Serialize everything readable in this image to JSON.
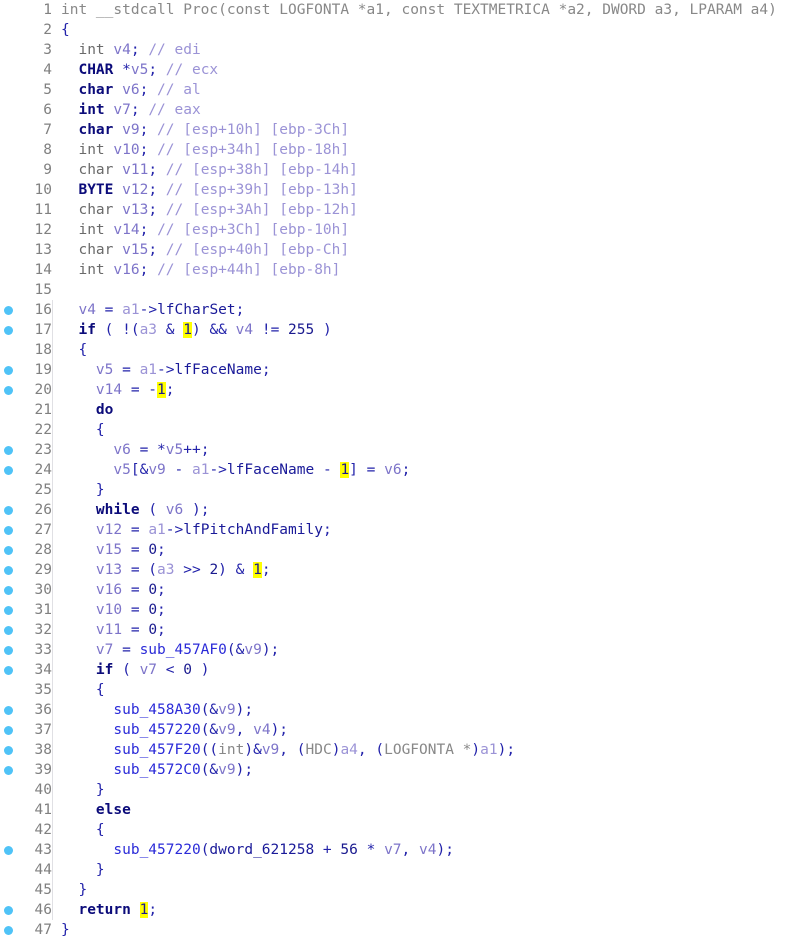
{
  "editor": {
    "kind": "decompiler-pseudocode-view",
    "accent_breakpoint_color": "#4fc3f7",
    "highlight_color": "#ffff00",
    "background_color": "#ffffff",
    "gutter_number_color": "#808080",
    "total_lines": 47
  },
  "lines": [
    {
      "n": "1",
      "bp": false,
      "tokens": [
        {
          "c": "t-grey",
          "s": "int __stdcall Proc(const LOGFONTA *a1, const TEXTMETRICA *a2, DWORD a3, LPARAM a4)"
        }
      ]
    },
    {
      "n": "2",
      "bp": false,
      "tokens": [
        {
          "c": "t-sym",
          "s": "{"
        }
      ]
    },
    {
      "n": "3",
      "bp": false,
      "tokens": [
        {
          "c": "t-plain",
          "s": "  int "
        },
        {
          "c": "t-var",
          "s": "v4"
        },
        {
          "c": "t-sym",
          "s": "; "
        },
        {
          "c": "t-comment",
          "s": "// edi"
        }
      ]
    },
    {
      "n": "4",
      "bp": false,
      "tokens": [
        {
          "c": "t-type",
          "s": "  CHAR "
        },
        {
          "c": "t-sym",
          "s": "*"
        },
        {
          "c": "t-var",
          "s": "v5"
        },
        {
          "c": "t-sym",
          "s": "; "
        },
        {
          "c": "t-comment",
          "s": "// ecx"
        }
      ]
    },
    {
      "n": "5",
      "bp": false,
      "tokens": [
        {
          "c": "t-type",
          "s": "  char "
        },
        {
          "c": "t-var",
          "s": "v6"
        },
        {
          "c": "t-sym",
          "s": "; "
        },
        {
          "c": "t-comment",
          "s": "// al"
        }
      ]
    },
    {
      "n": "6",
      "bp": false,
      "tokens": [
        {
          "c": "t-type",
          "s": "  int "
        },
        {
          "c": "t-var",
          "s": "v7"
        },
        {
          "c": "t-sym",
          "s": "; "
        },
        {
          "c": "t-comment",
          "s": "// eax"
        }
      ]
    },
    {
      "n": "7",
      "bp": false,
      "tokens": [
        {
          "c": "t-type",
          "s": "  char "
        },
        {
          "c": "t-var",
          "s": "v9"
        },
        {
          "c": "t-sym",
          "s": "; "
        },
        {
          "c": "t-comment",
          "s": "// [esp+10h] [ebp-3Ch]"
        }
      ]
    },
    {
      "n": "8",
      "bp": false,
      "tokens": [
        {
          "c": "t-plain",
          "s": "  int "
        },
        {
          "c": "t-var",
          "s": "v10"
        },
        {
          "c": "t-sym",
          "s": "; "
        },
        {
          "c": "t-comment",
          "s": "// [esp+34h] [ebp-18h]"
        }
      ]
    },
    {
      "n": "9",
      "bp": false,
      "tokens": [
        {
          "c": "t-plain",
          "s": "  char "
        },
        {
          "c": "t-var",
          "s": "v11"
        },
        {
          "c": "t-sym",
          "s": "; "
        },
        {
          "c": "t-comment",
          "s": "// [esp+38h] [ebp-14h]"
        }
      ]
    },
    {
      "n": "10",
      "bp": false,
      "tokens": [
        {
          "c": "t-type",
          "s": "  BYTE "
        },
        {
          "c": "t-var",
          "s": "v12"
        },
        {
          "c": "t-sym",
          "s": "; "
        },
        {
          "c": "t-comment",
          "s": "// [esp+39h] [ebp-13h]"
        }
      ]
    },
    {
      "n": "11",
      "bp": false,
      "tokens": [
        {
          "c": "t-plain",
          "s": "  char "
        },
        {
          "c": "t-var",
          "s": "v13"
        },
        {
          "c": "t-sym",
          "s": "; "
        },
        {
          "c": "t-comment",
          "s": "// [esp+3Ah] [ebp-12h]"
        }
      ]
    },
    {
      "n": "12",
      "bp": false,
      "tokens": [
        {
          "c": "t-plain",
          "s": "  int "
        },
        {
          "c": "t-var",
          "s": "v14"
        },
        {
          "c": "t-sym",
          "s": "; "
        },
        {
          "c": "t-comment",
          "s": "// [esp+3Ch] [ebp-10h]"
        }
      ]
    },
    {
      "n": "13",
      "bp": false,
      "tokens": [
        {
          "c": "t-plain",
          "s": "  char "
        },
        {
          "c": "t-var",
          "s": "v15"
        },
        {
          "c": "t-sym",
          "s": "; "
        },
        {
          "c": "t-comment",
          "s": "// [esp+40h] [ebp-Ch]"
        }
      ]
    },
    {
      "n": "14",
      "bp": false,
      "tokens": [
        {
          "c": "t-plain",
          "s": "  int "
        },
        {
          "c": "t-var",
          "s": "v16"
        },
        {
          "c": "t-sym",
          "s": "; "
        },
        {
          "c": "t-comment",
          "s": "// [esp+44h] [ebp-8h]"
        }
      ]
    },
    {
      "n": "15",
      "bp": false,
      "tokens": []
    },
    {
      "n": "16",
      "bp": true,
      "tokens": [
        {
          "c": "t-var",
          "s": "  v4 "
        },
        {
          "c": "t-sym",
          "s": "= "
        },
        {
          "c": "t-arg",
          "s": "a1"
        },
        {
          "c": "t-sym",
          "s": "->"
        },
        {
          "c": "t-member",
          "s": "lfCharSet"
        },
        {
          "c": "t-sym",
          "s": ";"
        }
      ]
    },
    {
      "n": "17",
      "bp": true,
      "tokens": [
        {
          "c": "t-kw",
          "s": "  if "
        },
        {
          "c": "t-sym",
          "s": "( !("
        },
        {
          "c": "t-arg",
          "s": "a3"
        },
        {
          "c": "t-sym",
          "s": " & "
        },
        {
          "c": "t-hl",
          "s": "1"
        },
        {
          "c": "t-sym",
          "s": ") && "
        },
        {
          "c": "t-var",
          "s": "v4"
        },
        {
          "c": "t-sym",
          "s": " != "
        },
        {
          "c": "t-num",
          "s": "255"
        },
        {
          "c": "t-sym",
          "s": " )"
        }
      ]
    },
    {
      "n": "18",
      "bp": false,
      "tokens": [
        {
          "c": "t-sym",
          "s": "  {"
        }
      ]
    },
    {
      "n": "19",
      "bp": true,
      "tokens": [
        {
          "c": "t-var",
          "s": "    v5 "
        },
        {
          "c": "t-sym",
          "s": "= "
        },
        {
          "c": "t-arg",
          "s": "a1"
        },
        {
          "c": "t-sym",
          "s": "->"
        },
        {
          "c": "t-member",
          "s": "lfFaceName"
        },
        {
          "c": "t-sym",
          "s": ";"
        }
      ]
    },
    {
      "n": "20",
      "bp": true,
      "tokens": [
        {
          "c": "t-var",
          "s": "    v14 "
        },
        {
          "c": "t-sym",
          "s": "= -"
        },
        {
          "c": "t-hl",
          "s": "1"
        },
        {
          "c": "t-sym",
          "s": ";"
        }
      ]
    },
    {
      "n": "21",
      "bp": false,
      "tokens": [
        {
          "c": "t-kw",
          "s": "    do"
        }
      ]
    },
    {
      "n": "22",
      "bp": false,
      "tokens": [
        {
          "c": "t-sym",
          "s": "    {"
        }
      ]
    },
    {
      "n": "23",
      "bp": true,
      "tokens": [
        {
          "c": "t-var",
          "s": "      v6 "
        },
        {
          "c": "t-sym",
          "s": "= *"
        },
        {
          "c": "t-var",
          "s": "v5"
        },
        {
          "c": "t-sym",
          "s": "++;"
        }
      ]
    },
    {
      "n": "24",
      "bp": true,
      "tokens": [
        {
          "c": "t-var",
          "s": "      v5"
        },
        {
          "c": "t-sym",
          "s": "[&"
        },
        {
          "c": "t-var",
          "s": "v9"
        },
        {
          "c": "t-sym",
          "s": " - "
        },
        {
          "c": "t-arg",
          "s": "a1"
        },
        {
          "c": "t-sym",
          "s": "->"
        },
        {
          "c": "t-member",
          "s": "lfFaceName"
        },
        {
          "c": "t-sym",
          "s": " - "
        },
        {
          "c": "t-hl",
          "s": "1"
        },
        {
          "c": "t-sym",
          "s": "] = "
        },
        {
          "c": "t-var",
          "s": "v6"
        },
        {
          "c": "t-sym",
          "s": ";"
        }
      ]
    },
    {
      "n": "25",
      "bp": false,
      "tokens": [
        {
          "c": "t-sym",
          "s": "    }"
        }
      ]
    },
    {
      "n": "26",
      "bp": true,
      "tokens": [
        {
          "c": "t-kw",
          "s": "    while "
        },
        {
          "c": "t-sym",
          "s": "( "
        },
        {
          "c": "t-var",
          "s": "v6"
        },
        {
          "c": "t-sym",
          "s": " );"
        }
      ]
    },
    {
      "n": "27",
      "bp": true,
      "tokens": [
        {
          "c": "t-var",
          "s": "    v12 "
        },
        {
          "c": "t-sym",
          "s": "= "
        },
        {
          "c": "t-arg",
          "s": "a1"
        },
        {
          "c": "t-sym",
          "s": "->"
        },
        {
          "c": "t-member",
          "s": "lfPitchAndFamily"
        },
        {
          "c": "t-sym",
          "s": ";"
        }
      ]
    },
    {
      "n": "28",
      "bp": true,
      "tokens": [
        {
          "c": "t-var",
          "s": "    v15 "
        },
        {
          "c": "t-sym",
          "s": "= "
        },
        {
          "c": "t-num",
          "s": "0"
        },
        {
          "c": "t-sym",
          "s": ";"
        }
      ]
    },
    {
      "n": "29",
      "bp": true,
      "tokens": [
        {
          "c": "t-var",
          "s": "    v13 "
        },
        {
          "c": "t-sym",
          "s": "= ("
        },
        {
          "c": "t-arg",
          "s": "a3"
        },
        {
          "c": "t-sym",
          "s": " >> "
        },
        {
          "c": "t-num",
          "s": "2"
        },
        {
          "c": "t-sym",
          "s": ") & "
        },
        {
          "c": "t-hl",
          "s": "1"
        },
        {
          "c": "t-sym",
          "s": ";"
        }
      ]
    },
    {
      "n": "30",
      "bp": true,
      "tokens": [
        {
          "c": "t-var",
          "s": "    v16 "
        },
        {
          "c": "t-sym",
          "s": "= "
        },
        {
          "c": "t-num",
          "s": "0"
        },
        {
          "c": "t-sym",
          "s": ";"
        }
      ]
    },
    {
      "n": "31",
      "bp": true,
      "tokens": [
        {
          "c": "t-var",
          "s": "    v10 "
        },
        {
          "c": "t-sym",
          "s": "= "
        },
        {
          "c": "t-num",
          "s": "0"
        },
        {
          "c": "t-sym",
          "s": ";"
        }
      ]
    },
    {
      "n": "32",
      "bp": true,
      "tokens": [
        {
          "c": "t-var",
          "s": "    v11 "
        },
        {
          "c": "t-sym",
          "s": "= "
        },
        {
          "c": "t-num",
          "s": "0"
        },
        {
          "c": "t-sym",
          "s": ";"
        }
      ]
    },
    {
      "n": "33",
      "bp": true,
      "tokens": [
        {
          "c": "t-var",
          "s": "    v7 "
        },
        {
          "c": "t-sym",
          "s": "= "
        },
        {
          "c": "t-func",
          "s": "sub_457AF0"
        },
        {
          "c": "t-sym",
          "s": "(&"
        },
        {
          "c": "t-var",
          "s": "v9"
        },
        {
          "c": "t-sym",
          "s": ");"
        }
      ]
    },
    {
      "n": "34",
      "bp": true,
      "tokens": [
        {
          "c": "t-kw",
          "s": "    if "
        },
        {
          "c": "t-sym",
          "s": "( "
        },
        {
          "c": "t-var",
          "s": "v7"
        },
        {
          "c": "t-sym",
          "s": " < "
        },
        {
          "c": "t-num",
          "s": "0"
        },
        {
          "c": "t-sym",
          "s": " )"
        }
      ]
    },
    {
      "n": "35",
      "bp": false,
      "tokens": [
        {
          "c": "t-sym",
          "s": "    {"
        }
      ]
    },
    {
      "n": "36",
      "bp": true,
      "tokens": [
        {
          "c": "t-func",
          "s": "      sub_458A30"
        },
        {
          "c": "t-sym",
          "s": "(&"
        },
        {
          "c": "t-var",
          "s": "v9"
        },
        {
          "c": "t-sym",
          "s": ");"
        }
      ]
    },
    {
      "n": "37",
      "bp": true,
      "tokens": [
        {
          "c": "t-func",
          "s": "      sub_457220"
        },
        {
          "c": "t-sym",
          "s": "(&"
        },
        {
          "c": "t-var",
          "s": "v9"
        },
        {
          "c": "t-sym",
          "s": ", "
        },
        {
          "c": "t-var",
          "s": "v4"
        },
        {
          "c": "t-sym",
          "s": ");"
        }
      ]
    },
    {
      "n": "38",
      "bp": true,
      "tokens": [
        {
          "c": "t-func",
          "s": "      sub_457F20"
        },
        {
          "c": "t-sym",
          "s": "(("
        },
        {
          "c": "t-grey",
          "s": "int"
        },
        {
          "c": "t-sym",
          "s": ")&"
        },
        {
          "c": "t-var",
          "s": "v9"
        },
        {
          "c": "t-sym",
          "s": ", ("
        },
        {
          "c": "t-grey",
          "s": "HDC"
        },
        {
          "c": "t-sym",
          "s": ")"
        },
        {
          "c": "t-arg",
          "s": "a4"
        },
        {
          "c": "t-sym",
          "s": ", ("
        },
        {
          "c": "t-grey",
          "s": "LOGFONTA *"
        },
        {
          "c": "t-sym",
          "s": ")"
        },
        {
          "c": "t-arg",
          "s": "a1"
        },
        {
          "c": "t-sym",
          "s": ");"
        }
      ]
    },
    {
      "n": "39",
      "bp": true,
      "tokens": [
        {
          "c": "t-func",
          "s": "      sub_4572C0"
        },
        {
          "c": "t-sym",
          "s": "(&"
        },
        {
          "c": "t-var",
          "s": "v9"
        },
        {
          "c": "t-sym",
          "s": ");"
        }
      ]
    },
    {
      "n": "40",
      "bp": false,
      "tokens": [
        {
          "c": "t-sym",
          "s": "    }"
        }
      ]
    },
    {
      "n": "41",
      "bp": false,
      "tokens": [
        {
          "c": "t-kw",
          "s": "    else"
        }
      ]
    },
    {
      "n": "42",
      "bp": false,
      "tokens": [
        {
          "c": "t-sym",
          "s": "    {"
        }
      ]
    },
    {
      "n": "43",
      "bp": true,
      "tokens": [
        {
          "c": "t-func",
          "s": "      sub_457220"
        },
        {
          "c": "t-sym",
          "s": "("
        },
        {
          "c": "t-global",
          "s": "dword_621258"
        },
        {
          "c": "t-sym",
          "s": " + "
        },
        {
          "c": "t-num",
          "s": "56"
        },
        {
          "c": "t-sym",
          "s": " * "
        },
        {
          "c": "t-var",
          "s": "v7"
        },
        {
          "c": "t-sym",
          "s": ", "
        },
        {
          "c": "t-var",
          "s": "v4"
        },
        {
          "c": "t-sym",
          "s": ");"
        }
      ]
    },
    {
      "n": "44",
      "bp": false,
      "tokens": [
        {
          "c": "t-sym",
          "s": "    }"
        }
      ]
    },
    {
      "n": "45",
      "bp": false,
      "tokens": [
        {
          "c": "t-sym",
          "s": "  }"
        }
      ]
    },
    {
      "n": "46",
      "bp": true,
      "tokens": [
        {
          "c": "t-kw",
          "s": "  return "
        },
        {
          "c": "t-hl",
          "s": "1"
        },
        {
          "c": "t-sym",
          "s": ";"
        }
      ]
    },
    {
      "n": "47",
      "bp": true,
      "tokens": [
        {
          "c": "t-sym",
          "s": "}"
        }
      ]
    }
  ]
}
